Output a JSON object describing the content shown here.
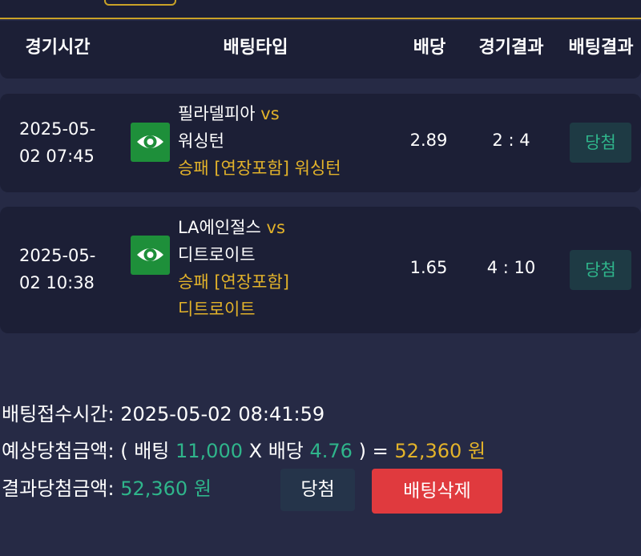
{
  "header": {
    "col_time": "경기시간",
    "col_type": "배팅타입",
    "col_odds": "배당",
    "col_game_result": "경기결과",
    "col_bet_result": "배팅결과"
  },
  "rows": [
    {
      "date": "2025-05-",
      "time": "02 07:45",
      "home": "필라델피아",
      "vs": "vs",
      "away": "워싱턴",
      "bet_line1": "승패 [연장포함] 워싱턴",
      "bet_line2": "",
      "odds": "2.89",
      "score": "2 : 4",
      "result": "당첨"
    },
    {
      "date": "2025-05-",
      "time": "02 10:38",
      "home": "LA에인절스",
      "vs": "vs",
      "away": "디트로이트",
      "bet_line1": "승패 [연장포함]",
      "bet_line2": "디트로이트",
      "odds": "1.65",
      "score": "4 : 10",
      "result": "당첨"
    }
  ],
  "summary": {
    "received_label": "배팅접수시간:",
    "received_value": "2025-05-02 08:41:59",
    "expected_label": "예상당첨금액:",
    "expected_open": "( 배팅",
    "bet_amount": "11,000",
    "x_sep": "X 배당",
    "total_odds": "4.76",
    "expected_close": ") =",
    "expected_payout": "52,360 원",
    "result_label": "결과당첨금액:",
    "result_payout": "52,360 원"
  },
  "actions": {
    "win_label": "당첨",
    "delete_label": "배팅삭제"
  },
  "colors": {
    "background": "#262a45",
    "card": "#1c1f36",
    "accent_gold": "#e3b32a",
    "accent_green": "#2fb58b",
    "delete_red": "#e03a3e",
    "eye_green": "#1e8f3a"
  }
}
